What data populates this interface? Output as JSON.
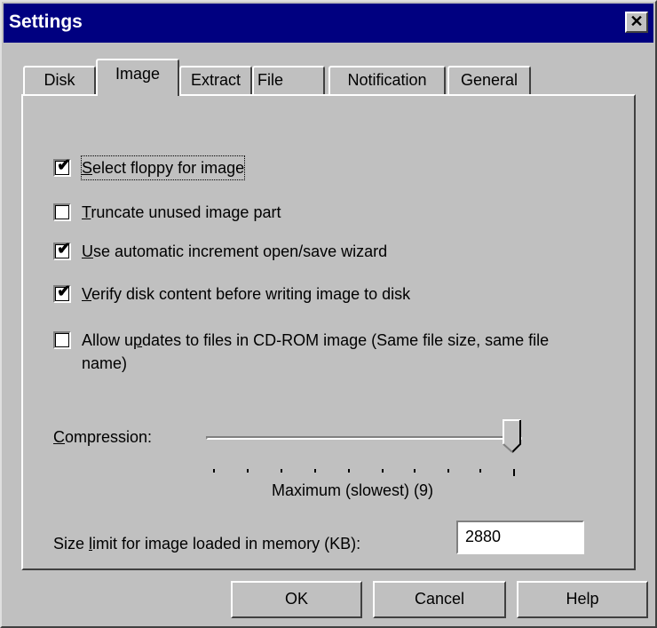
{
  "window": {
    "title": "Settings",
    "close_glyph": "✕"
  },
  "tabs": [
    {
      "label": "Disk"
    },
    {
      "label": "Image"
    },
    {
      "label": "Extract"
    },
    {
      "label": "File"
    },
    {
      "label": "Notification"
    },
    {
      "label": "General"
    }
  ],
  "active_tab": "Image",
  "checkboxes": [
    {
      "mnemonic": "S",
      "rest": "elect floppy for image",
      "checked": true
    },
    {
      "mnemonic": "T",
      "rest": "runcate unused image part",
      "checked": false
    },
    {
      "mnemonic": "U",
      "rest": "se automatic increment open/save wizard",
      "checked": true
    },
    {
      "mnemonic": "V",
      "rest": "erify disk content before writing image to disk",
      "checked": true
    },
    {
      "pre": "Allow u",
      "mnemonic": "p",
      "rest": "dates to files in CD-ROM image (Same file size, same file name)",
      "checked": false
    }
  ],
  "compression": {
    "label_mnemonic": "C",
    "label_rest": "ompression:",
    "value": 9,
    "min": 0,
    "max": 9,
    "value_text": "Maximum (slowest) (9)"
  },
  "size_limit": {
    "pre": "Size ",
    "mnemonic": "l",
    "rest": "imit for image loaded in memory (KB):",
    "value": "2880"
  },
  "buttons": {
    "ok": "OK",
    "cancel": "Cancel",
    "help": "Help"
  },
  "check_glyph": "✔"
}
